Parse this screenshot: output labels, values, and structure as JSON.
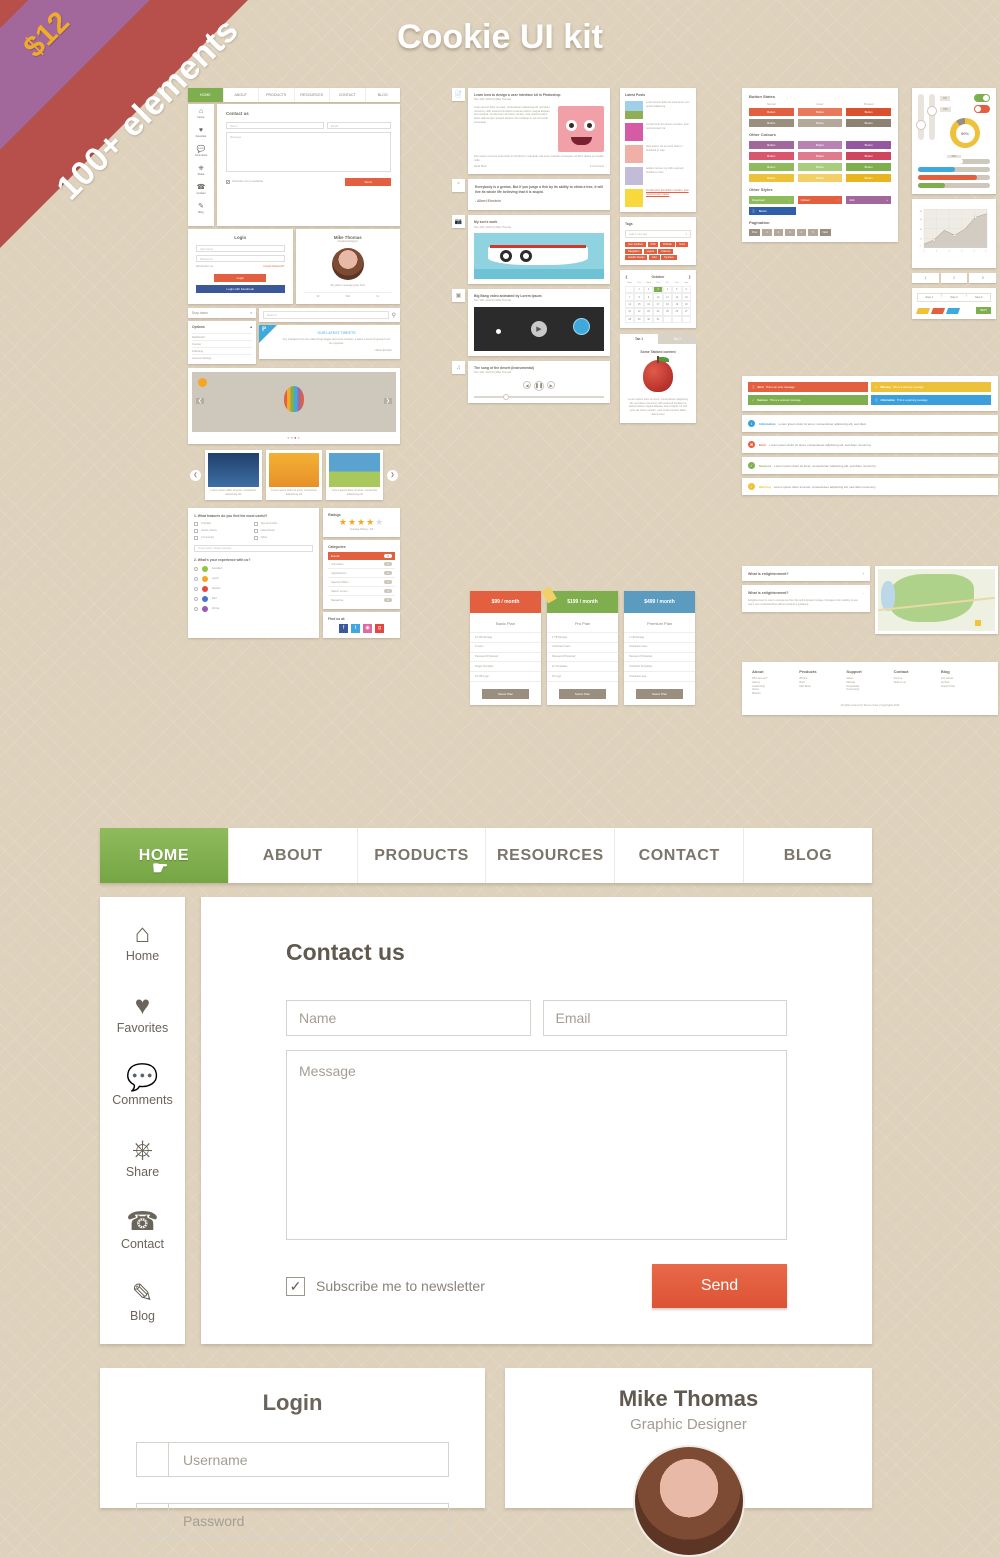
{
  "ribbon": {
    "price": "$12",
    "text": "100+ elements"
  },
  "header": {
    "title": "Cookie UI kit"
  },
  "nav": {
    "items": [
      {
        "label": "HOME",
        "active": true
      },
      {
        "label": "ABOUT",
        "active": false
      },
      {
        "label": "PRODUCTS",
        "active": false
      },
      {
        "label": "RESOURCES",
        "active": false
      },
      {
        "label": "CONTACT",
        "active": false
      },
      {
        "label": "BLOG",
        "active": false
      }
    ]
  },
  "sidebar": {
    "items": [
      {
        "label": "Home",
        "icon": "home-icon",
        "glyph": "⌂"
      },
      {
        "label": "Favorites",
        "icon": "heart-icon",
        "glyph": "♥"
      },
      {
        "label": "Comments",
        "icon": "comments-icon",
        "glyph": "💬"
      },
      {
        "label": "Share",
        "icon": "share-icon",
        "glyph": "☲"
      },
      {
        "label": "Contact",
        "icon": "phone-icon",
        "glyph": "☎"
      },
      {
        "label": "Blog",
        "icon": "pencil-icon",
        "glyph": "✎"
      }
    ]
  },
  "contact_form": {
    "title": "Contact us",
    "name_placeholder": "Name",
    "email_placeholder": "Email",
    "message_placeholder": "Message",
    "checkbox_label": "Subscribe me to newsletter",
    "checkbox_checked": true,
    "send_label": "Send"
  },
  "login": {
    "title": "Login",
    "username_placeholder": "Username",
    "password_placeholder": "Password",
    "remember_label": "Remember me",
    "forgot_label": "Forgot Password?",
    "login_button": "Login",
    "facebook_button": "Login with Facebook"
  },
  "profile": {
    "name": "Mike Thomas",
    "role": "Graphic Designer",
    "status": "My status message goes here",
    "stats": [
      "23",
      "542",
      "11"
    ]
  },
  "mosaic": {
    "blog_posts": [
      {
        "title": "Learn how to design a user interface kit in Photoshop",
        "meta": "Nov 11th, 2013 by Mike Thomas",
        "read_more": "Read More",
        "comments": "3 comments"
      },
      {
        "title": "My son's work",
        "meta": "Nov 11th, 2013 by Mike Thomas"
      },
      {
        "title": "Big Bang video animated by Lorem Ipsum",
        "meta": "Nov 11th, 2013 by Mike Thomas"
      },
      {
        "title": "The song of the desert (Instrumental)",
        "meta": "Nov 11th, 2013 by Mike Thomas"
      }
    ],
    "quote": {
      "text": "Everybody is a genius. But if you judge a fish by its ability to climb a tree, it will live its whole life believing that it is stupid.",
      "author": "- Albert Einstein"
    },
    "latest_posts_title": "Latest Posts",
    "tags_title": "Tags",
    "tags_placeholder": "Add a new tag",
    "tags": [
      "User Interface",
      "PSD",
      "Portfolio",
      "Icons",
      "Navigation",
      "Layers",
      "Patterns",
      "Graphic Design",
      "Grid",
      "Typeface"
    ],
    "calendar": {
      "month": "October",
      "days": [
        "Mon",
        "Tue",
        "Wed",
        "Thu",
        "Fri",
        "Sat",
        "Sun"
      ],
      "selected": "3"
    },
    "tabs": {
      "tab1": "Tab 1",
      "tab2": "Tab 2",
      "content_title": "Some Tabbed content"
    },
    "dropdown_label": "Drop-down",
    "options_title": "Options",
    "options": [
      "Dashboard",
      "Counter",
      "Following",
      "Account Settings"
    ],
    "search_placeholder": "Search",
    "tweets_title": "OUR LATEST TWEETS",
    "tweet_text": "Any intelligent fool can make things bigger and more complex. It takes a touch of genius to do the opposite.",
    "tweet_author": "- Albert Einstein",
    "survey": {
      "q1": "1. What features do you find the most useful?",
      "q1_options": [
        "Tutorials",
        "Tips and tricks",
        "Article Library",
        "Latest News",
        "Community",
        "Other"
      ],
      "q1_other_placeholder": "If any other, please specify...",
      "q2": "2. What's your experience with us?",
      "q2_options": [
        "Excellent",
        "Good",
        "Neutral",
        "Bad",
        "Worse"
      ]
    },
    "ratings": {
      "title": "Ratings",
      "caption": "Average Rating : 4/5",
      "stars": 4
    },
    "categories": {
      "title": "Categories",
      "items": [
        "Events",
        "Animation",
        "Applications",
        "Special Offers",
        "Select Lorem",
        "Magazine"
      ]
    },
    "findus": {
      "title": "Find us at:",
      "icons": [
        "facebook-icon",
        "twitter-icon",
        "dribbble-icon",
        "google-plus-icon"
      ]
    },
    "pricing": [
      {
        "price": "$99 / month",
        "plan": "Basic Plan",
        "features": [
          "10 GB Storage",
          "5 users",
          "Password Protected",
          "Single Template",
          "10 GB Logs"
        ],
        "cta": "Select Plan",
        "color": "#e2603f"
      },
      {
        "price": "$199 / month",
        "plan": "Pro Plan",
        "features": [
          "1 TB Storage",
          "Unlimited Users",
          "Password Protected",
          "10 Templates",
          "10 Logs"
        ],
        "cta": "Select Plan",
        "color": "#7fae4f"
      },
      {
        "price": "$499 / month",
        "plan": "Premium Plan",
        "features": [
          "1 TB Storage",
          "Unlimited Users",
          "Password Protected",
          "Unlimited Templates",
          "Unlimited Logs"
        ],
        "cta": "Select Plan",
        "color": "#5b9bc0"
      }
    ],
    "buttons_panel": {
      "title": "Button States",
      "states": [
        "Normal",
        "Hover",
        "Pressed"
      ],
      "label": "Button",
      "other_colours": "Other Colours",
      "other_styles": "Other Styles",
      "styles": [
        "Download",
        "Upload",
        "Add",
        "Button"
      ],
      "pagination_title": "Pagination",
      "pagination": [
        "Prev",
        "1",
        "2",
        "3",
        "4",
        "5",
        "Next"
      ]
    },
    "alerts_inline": [
      {
        "type": "Error",
        "text": "This is an error message",
        "color": "#e2603f"
      },
      {
        "type": "Warning",
        "text": "This is a warning message",
        "color": "#eec13b"
      },
      {
        "type": "Success",
        "text": "This is a success message",
        "color": "#7fae4f"
      },
      {
        "type": "Information",
        "text": "This is a warning message",
        "color": "#3a9fdc"
      }
    ],
    "alerts_list": [
      {
        "type": "Information",
        "text": "Lorem ipsum dolor sit amet, consectetuer adipiscing elit, sed diam",
        "color": "#3a9fdc"
      },
      {
        "type": "Error",
        "text": "Lorem ipsum dolor sit amet, consectetuer adipiscing elit, sed diam nonummy",
        "color": "#e2603f"
      },
      {
        "type": "Success",
        "text": "Lorem ipsum dolor sit amet, consectetuer adipiscing elit, sed diam nonummy",
        "color": "#7fae4f"
      },
      {
        "type": "Warning",
        "text": "Lorem ipsum dolor sit amet, consectetuer adipiscing elit, sed diam nonummy",
        "color": "#eec13b"
      }
    ],
    "accordion": [
      {
        "q": "What is enlightenment?",
        "sign": "+",
        "open": false
      },
      {
        "q": "What is enlightenment?",
        "sign": "-",
        "open": true,
        "a": "Enlightenment is man's emergence from his self-imposed nonage. Nonage is the inability to use one's own understanding without another's guidance."
      }
    ],
    "footer": {
      "columns": [
        {
          "title": "About",
          "links": [
            "Who are we?",
            "History",
            "Leadership",
            "Vision",
            "Mission"
          ]
        },
        {
          "title": "Products",
          "links": [
            "iPhone",
            "iPad",
            "Mac Book"
          ]
        },
        {
          "title": "Support",
          "links": [
            "Video",
            "Manual",
            "Downloads",
            "Community"
          ]
        },
        {
          "title": "Contact",
          "links": [
            "Find us",
            "Write to us"
          ]
        },
        {
          "title": "Blog",
          "links": [
            "Our values",
            "Archive",
            "Latest Posts"
          ]
        }
      ],
      "copyright": "All rights reserved | Terms of use | Copyrights 2014"
    },
    "widgets": {
      "percent": "90%",
      "toggle_on": "ON",
      "toggle_off": "OFF",
      "progress_label": "50%",
      "steps_numbers": [
        "1",
        "2",
        "3"
      ],
      "steps_labels": [
        "Step 1",
        "Step 2",
        "Step 3"
      ],
      "back_label": "BACK",
      "next_label": "NEXT"
    }
  },
  "chart_data": {
    "type": "area",
    "title": "",
    "x": [
      0,
      1,
      2,
      3,
      4,
      5,
      6
    ],
    "values": [
      8,
      16,
      36,
      26,
      38,
      64,
      72
    ],
    "xlabel": "",
    "ylabel": "",
    "ylim": [
      0,
      80
    ],
    "grid": true
  }
}
